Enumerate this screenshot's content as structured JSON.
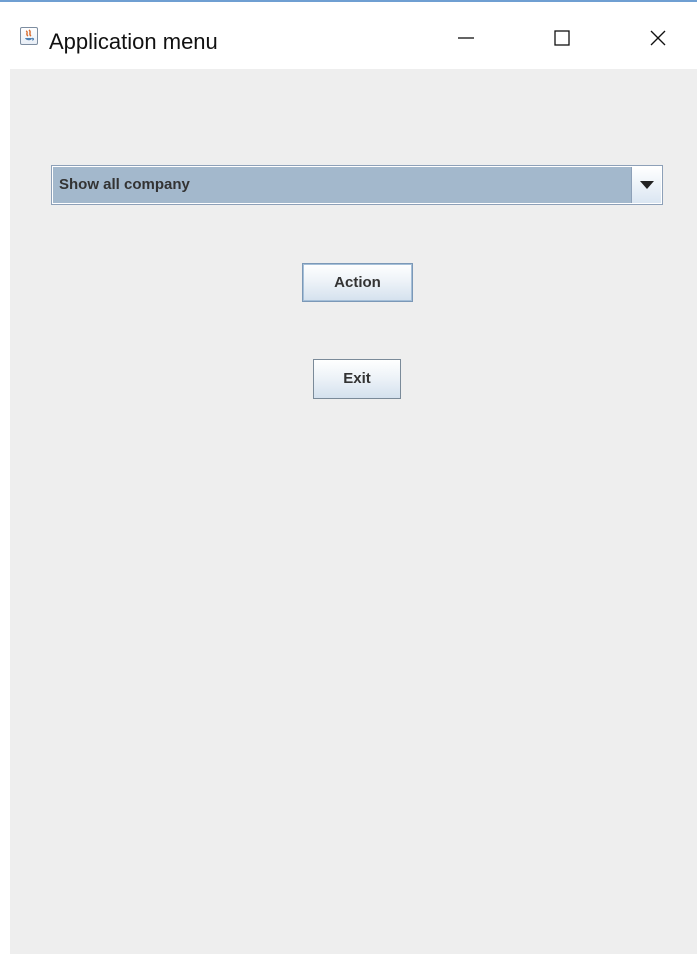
{
  "window": {
    "title": "Application menu",
    "controls": {
      "minimize": "minimize-icon",
      "maximize": "maximize-icon",
      "close": "close-icon"
    }
  },
  "form": {
    "dropdown": {
      "selected_value": "Show all company",
      "arrow_icon": "chevron-down-icon"
    },
    "buttons": {
      "action_label": "Action",
      "exit_label": "Exit"
    }
  },
  "colors": {
    "window_background": "#eeeeee",
    "dropdown_selected_background": "#a3b8cc",
    "button_text": "#333333",
    "title_text": "#111111"
  }
}
